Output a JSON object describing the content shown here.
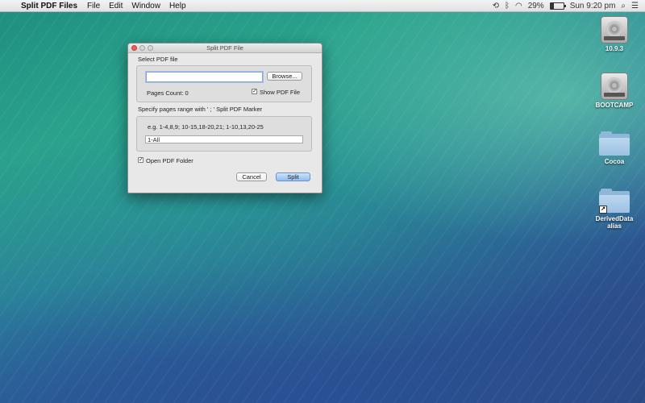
{
  "menubar": {
    "apple_symbol": "",
    "app_name": "Split PDF Files",
    "menus": [
      "File",
      "Edit",
      "Window",
      "Help"
    ],
    "battery_percent": "29%",
    "battery_level": 0.29,
    "clock": "Sun 9:20 pm",
    "icons": [
      "time-machine-icon",
      "bluetooth-icon",
      "wifi-icon",
      "battery-icon",
      "search-icon",
      "notification-center-icon"
    ]
  },
  "window": {
    "title": "Split PDF File",
    "select_label": "Select PDF file",
    "file_path_value": "",
    "browse_label": "Browse...",
    "pages_count_label": "Pages Count: 0",
    "show_pdf_label": "Show PDF File",
    "show_pdf_checked": true,
    "range_label": "Specify pages range with ' ; ' Split PDF Marker",
    "example_text": "e.g. 1-4,8,9; 10-15,18-20,21; 1-10,13,20-25",
    "range_value": "1-All",
    "open_folder_label": "Open PDF Folder",
    "open_folder_checked": true,
    "cancel_label": "Cancel",
    "split_label": "Split"
  },
  "desktop_icons": [
    {
      "label": "10.9.3",
      "type": "drive"
    },
    {
      "label": "BOOTCAMP",
      "type": "drive"
    },
    {
      "label": "Cocoa",
      "type": "folder"
    },
    {
      "label": "DerivedData alias",
      "type": "folder-alias"
    }
  ]
}
